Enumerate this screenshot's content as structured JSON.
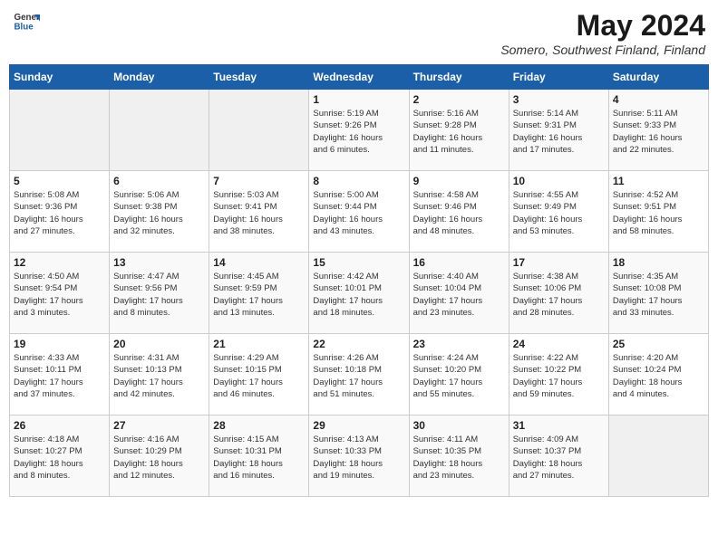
{
  "header": {
    "logo_general": "General",
    "logo_blue": "Blue",
    "month_title": "May 2024",
    "location": "Somero, Southwest Finland, Finland"
  },
  "days_of_week": [
    "Sunday",
    "Monday",
    "Tuesday",
    "Wednesday",
    "Thursday",
    "Friday",
    "Saturday"
  ],
  "weeks": [
    [
      {
        "day": "",
        "info": ""
      },
      {
        "day": "",
        "info": ""
      },
      {
        "day": "",
        "info": ""
      },
      {
        "day": "1",
        "info": "Sunrise: 5:19 AM\nSunset: 9:26 PM\nDaylight: 16 hours\nand 6 minutes."
      },
      {
        "day": "2",
        "info": "Sunrise: 5:16 AM\nSunset: 9:28 PM\nDaylight: 16 hours\nand 11 minutes."
      },
      {
        "day": "3",
        "info": "Sunrise: 5:14 AM\nSunset: 9:31 PM\nDaylight: 16 hours\nand 17 minutes."
      },
      {
        "day": "4",
        "info": "Sunrise: 5:11 AM\nSunset: 9:33 PM\nDaylight: 16 hours\nand 22 minutes."
      }
    ],
    [
      {
        "day": "5",
        "info": "Sunrise: 5:08 AM\nSunset: 9:36 PM\nDaylight: 16 hours\nand 27 minutes."
      },
      {
        "day": "6",
        "info": "Sunrise: 5:06 AM\nSunset: 9:38 PM\nDaylight: 16 hours\nand 32 minutes."
      },
      {
        "day": "7",
        "info": "Sunrise: 5:03 AM\nSunset: 9:41 PM\nDaylight: 16 hours\nand 38 minutes."
      },
      {
        "day": "8",
        "info": "Sunrise: 5:00 AM\nSunset: 9:44 PM\nDaylight: 16 hours\nand 43 minutes."
      },
      {
        "day": "9",
        "info": "Sunrise: 4:58 AM\nSunset: 9:46 PM\nDaylight: 16 hours\nand 48 minutes."
      },
      {
        "day": "10",
        "info": "Sunrise: 4:55 AM\nSunset: 9:49 PM\nDaylight: 16 hours\nand 53 minutes."
      },
      {
        "day": "11",
        "info": "Sunrise: 4:52 AM\nSunset: 9:51 PM\nDaylight: 16 hours\nand 58 minutes."
      }
    ],
    [
      {
        "day": "12",
        "info": "Sunrise: 4:50 AM\nSunset: 9:54 PM\nDaylight: 17 hours\nand 3 minutes."
      },
      {
        "day": "13",
        "info": "Sunrise: 4:47 AM\nSunset: 9:56 PM\nDaylight: 17 hours\nand 8 minutes."
      },
      {
        "day": "14",
        "info": "Sunrise: 4:45 AM\nSunset: 9:59 PM\nDaylight: 17 hours\nand 13 minutes."
      },
      {
        "day": "15",
        "info": "Sunrise: 4:42 AM\nSunset: 10:01 PM\nDaylight: 17 hours\nand 18 minutes."
      },
      {
        "day": "16",
        "info": "Sunrise: 4:40 AM\nSunset: 10:04 PM\nDaylight: 17 hours\nand 23 minutes."
      },
      {
        "day": "17",
        "info": "Sunrise: 4:38 AM\nSunset: 10:06 PM\nDaylight: 17 hours\nand 28 minutes."
      },
      {
        "day": "18",
        "info": "Sunrise: 4:35 AM\nSunset: 10:08 PM\nDaylight: 17 hours\nand 33 minutes."
      }
    ],
    [
      {
        "day": "19",
        "info": "Sunrise: 4:33 AM\nSunset: 10:11 PM\nDaylight: 17 hours\nand 37 minutes."
      },
      {
        "day": "20",
        "info": "Sunrise: 4:31 AM\nSunset: 10:13 PM\nDaylight: 17 hours\nand 42 minutes."
      },
      {
        "day": "21",
        "info": "Sunrise: 4:29 AM\nSunset: 10:15 PM\nDaylight: 17 hours\nand 46 minutes."
      },
      {
        "day": "22",
        "info": "Sunrise: 4:26 AM\nSunset: 10:18 PM\nDaylight: 17 hours\nand 51 minutes."
      },
      {
        "day": "23",
        "info": "Sunrise: 4:24 AM\nSunset: 10:20 PM\nDaylight: 17 hours\nand 55 minutes."
      },
      {
        "day": "24",
        "info": "Sunrise: 4:22 AM\nSunset: 10:22 PM\nDaylight: 17 hours\nand 59 minutes."
      },
      {
        "day": "25",
        "info": "Sunrise: 4:20 AM\nSunset: 10:24 PM\nDaylight: 18 hours\nand 4 minutes."
      }
    ],
    [
      {
        "day": "26",
        "info": "Sunrise: 4:18 AM\nSunset: 10:27 PM\nDaylight: 18 hours\nand 8 minutes."
      },
      {
        "day": "27",
        "info": "Sunrise: 4:16 AM\nSunset: 10:29 PM\nDaylight: 18 hours\nand 12 minutes."
      },
      {
        "day": "28",
        "info": "Sunrise: 4:15 AM\nSunset: 10:31 PM\nDaylight: 18 hours\nand 16 minutes."
      },
      {
        "day": "29",
        "info": "Sunrise: 4:13 AM\nSunset: 10:33 PM\nDaylight: 18 hours\nand 19 minutes."
      },
      {
        "day": "30",
        "info": "Sunrise: 4:11 AM\nSunset: 10:35 PM\nDaylight: 18 hours\nand 23 minutes."
      },
      {
        "day": "31",
        "info": "Sunrise: 4:09 AM\nSunset: 10:37 PM\nDaylight: 18 hours\nand 27 minutes."
      },
      {
        "day": "",
        "info": ""
      }
    ]
  ]
}
